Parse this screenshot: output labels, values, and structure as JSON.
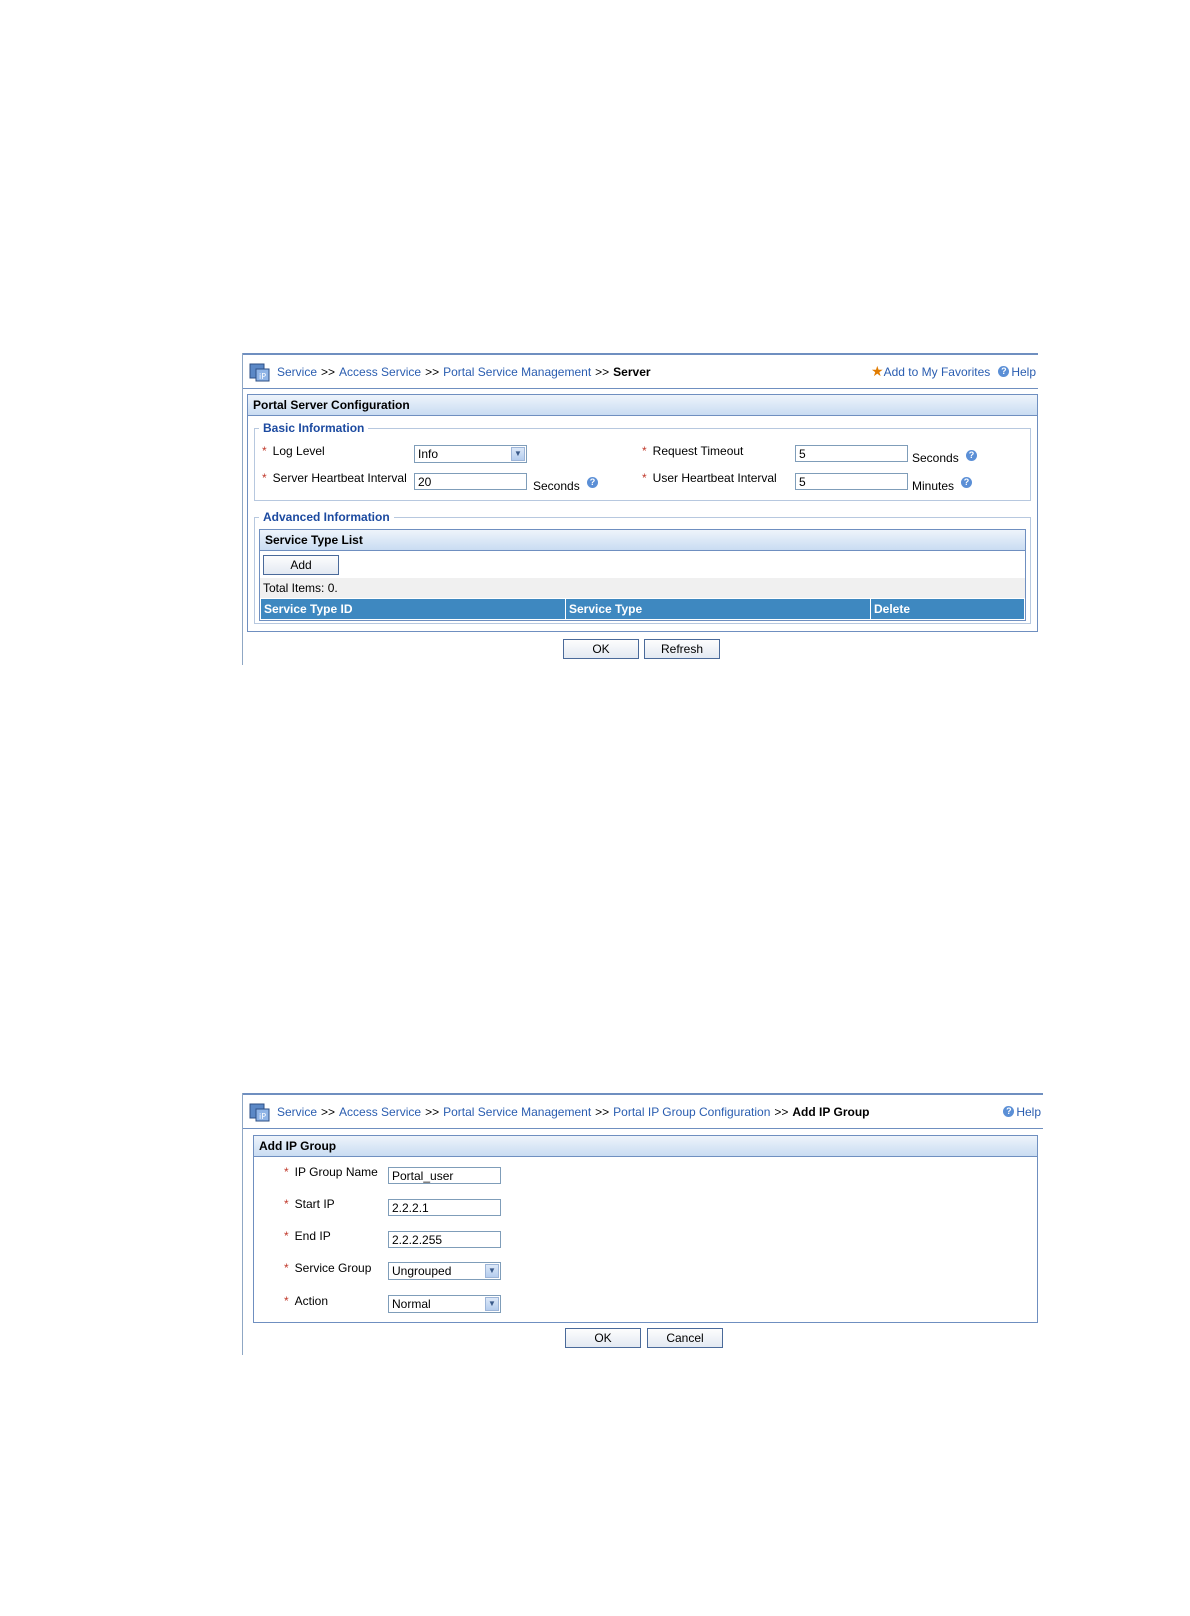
{
  "shot1": {
    "breadcrumb": [
      "Service",
      "Access Service",
      "Portal Service Management"
    ],
    "breadcrumb_sep": ">>",
    "breadcrumb_current": "Server",
    "favorites_label": "Add to My Favorites",
    "help_label": "Help",
    "panel_title": "Portal Server Configuration",
    "basic_legend": "Basic Information",
    "log_level_label": "Log Level",
    "log_level_value": "Info",
    "request_timeout_label": "Request Timeout",
    "request_timeout_value": "5",
    "request_timeout_unit": "Seconds",
    "server_hb_label": "Server Heartbeat Interval",
    "server_hb_value": "20",
    "server_hb_unit": "Seconds",
    "user_hb_label": "User Heartbeat Interval",
    "user_hb_value": "5",
    "user_hb_unit": "Minutes",
    "advanced_legend": "Advanced Information",
    "list_title": "Service Type List",
    "add_label": "Add",
    "total_items": "Total Items: 0.",
    "columns": [
      "Service Type ID",
      "Service Type",
      "Delete"
    ],
    "ok_label": "OK",
    "refresh_label": "Refresh"
  },
  "shot2": {
    "breadcrumb": [
      "Service",
      "Access Service",
      "Portal Service Management",
      "Portal IP Group Configuration"
    ],
    "breadcrumb_sep": ">>",
    "breadcrumb_current": "Add IP Group",
    "help_label": "Help",
    "panel_title": "Add IP Group",
    "fields": {
      "ip_group_name": {
        "label": "IP Group Name",
        "value": "Portal_user"
      },
      "start_ip": {
        "label": "Start IP",
        "value": "2.2.2.1"
      },
      "end_ip": {
        "label": "End IP",
        "value": "2.2.2.255"
      },
      "service_group": {
        "label": "Service Group",
        "value": "Ungrouped"
      },
      "action": {
        "label": "Action",
        "value": "Normal"
      }
    },
    "ok_label": "OK",
    "cancel_label": "Cancel"
  },
  "colors": {
    "link": "#2a5db0",
    "legend": "#1c4aa0",
    "header_bar": "#3e88c0",
    "required_star": "#c0392b"
  }
}
